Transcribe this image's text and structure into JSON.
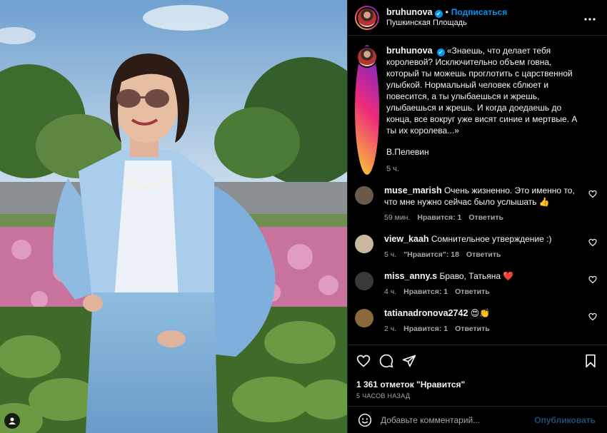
{
  "post": {
    "username": "bruhunova",
    "verified_glyph": "✔",
    "separator": "•",
    "follow_label": "Подписаться",
    "location": "Пушкинская Площадь",
    "more_icon": "more-horizontal-icon"
  },
  "caption": {
    "username": "bruhunova",
    "text": "«Знаешь, что делает тебя королевой? Исключительно объем говна, который ты можешь проглотить с царственной улыбкой. Нормальный человек сблюет и повесится, а ты улыбаешься и жрешь, улыбаешься и жрешь. И когда доедаешь до конца, все вокруг уже висят синие и мертвые. А ты их королева...»",
    "signature": "В.Пелевин",
    "time": "5 ч."
  },
  "comments": [
    {
      "username": "muse_marish",
      "text": "Очень жизненно. Это именно то, что мне нужно сейчас было услышать 👍",
      "time": "59 мин.",
      "likes": "Нравится: 1",
      "reply": "Ответить",
      "avatar_color": "#6b5a4a"
    },
    {
      "username": "view_kaah",
      "text": "Сомнительное утверждение :)",
      "time": "5 ч.",
      "likes": "\"Нравится\": 18",
      "reply": "Ответить",
      "avatar_color": "#c9b8a0"
    },
    {
      "username": "miss_anny.s",
      "text": "Браво, Татьяна ❤️",
      "time": "4 ч.",
      "likes": "Нравится: 1",
      "reply": "Ответить",
      "avatar_color": "#3a3a3a"
    },
    {
      "username": "tatianadronova2742",
      "text": "😍👏",
      "time": "2 ч.",
      "likes": "Нравится: 1",
      "reply": "Ответить",
      "avatar_color": "#8a6a3a"
    }
  ],
  "actions": {
    "likes_text": "1 361 отметок \"Нравится\"",
    "ago_text": "5 ЧАСОВ НАЗАД"
  },
  "composer": {
    "placeholder": "Добавьте комментарий...",
    "publish_label": "Опубликовать"
  },
  "colors": {
    "accent": "#0095f6",
    "publish_disabled": "#1e4f79",
    "muted": "#a8a8a8"
  }
}
